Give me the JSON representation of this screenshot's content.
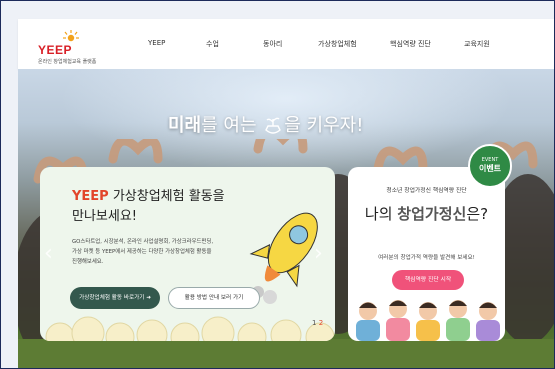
{
  "logo": {
    "wordmark": "YEEP",
    "subtitle": "온라인 창업체험교육 플랫폼",
    "tagline": ""
  },
  "nav": {
    "items": [
      "YEEP",
      "수업",
      "동아리",
      "가상창업체험",
      "핵심역량 진단",
      "교육지원"
    ]
  },
  "hero": {
    "headline_strong": "미래",
    "headline_rest": "를 여는 ",
    "headline_end": "을 키우자!"
  },
  "card1": {
    "title_accent": "YEEP",
    "title_line1_rest": " 가상창업체험 활동을",
    "title_line2": "만나보세요!",
    "desc_lines": [
      "GO스타트업, 시장분석, 온라인 사업설명회, 가상크라우드펀딩,",
      "가상 마켓 등 YEEP에서 제공하는 다양한 가상창업체험 활동을",
      "진행해보세요."
    ],
    "btn_primary": "가상창업체험 활동 바로가기  ➜",
    "btn_secondary": "활용 방법 안내 보러 가기",
    "pager_current": "1",
    "pager_sep": " ",
    "pager_other": "2",
    "pause": "II"
  },
  "card2": {
    "small": "청소년 창업가정신 핵심역량 진단",
    "big_prefix": "나의 ",
    "big_bold": "창업가정신",
    "big_suffix": "은?",
    "desc": "여러분의 창업가적 역량을 발견해 보세요!",
    "btn": "핵심역량 진단 시작"
  },
  "event": {
    "line1": "EVENT",
    "line2": "이벤트"
  },
  "arrows": {
    "prev": "‹",
    "next": "›"
  },
  "colors": {
    "brand_red": "#d81f26",
    "accent_orange": "#e2452a",
    "pink_button": "#f0527a",
    "dark_green_button": "#33584d",
    "event_green": "#2f8a45"
  }
}
